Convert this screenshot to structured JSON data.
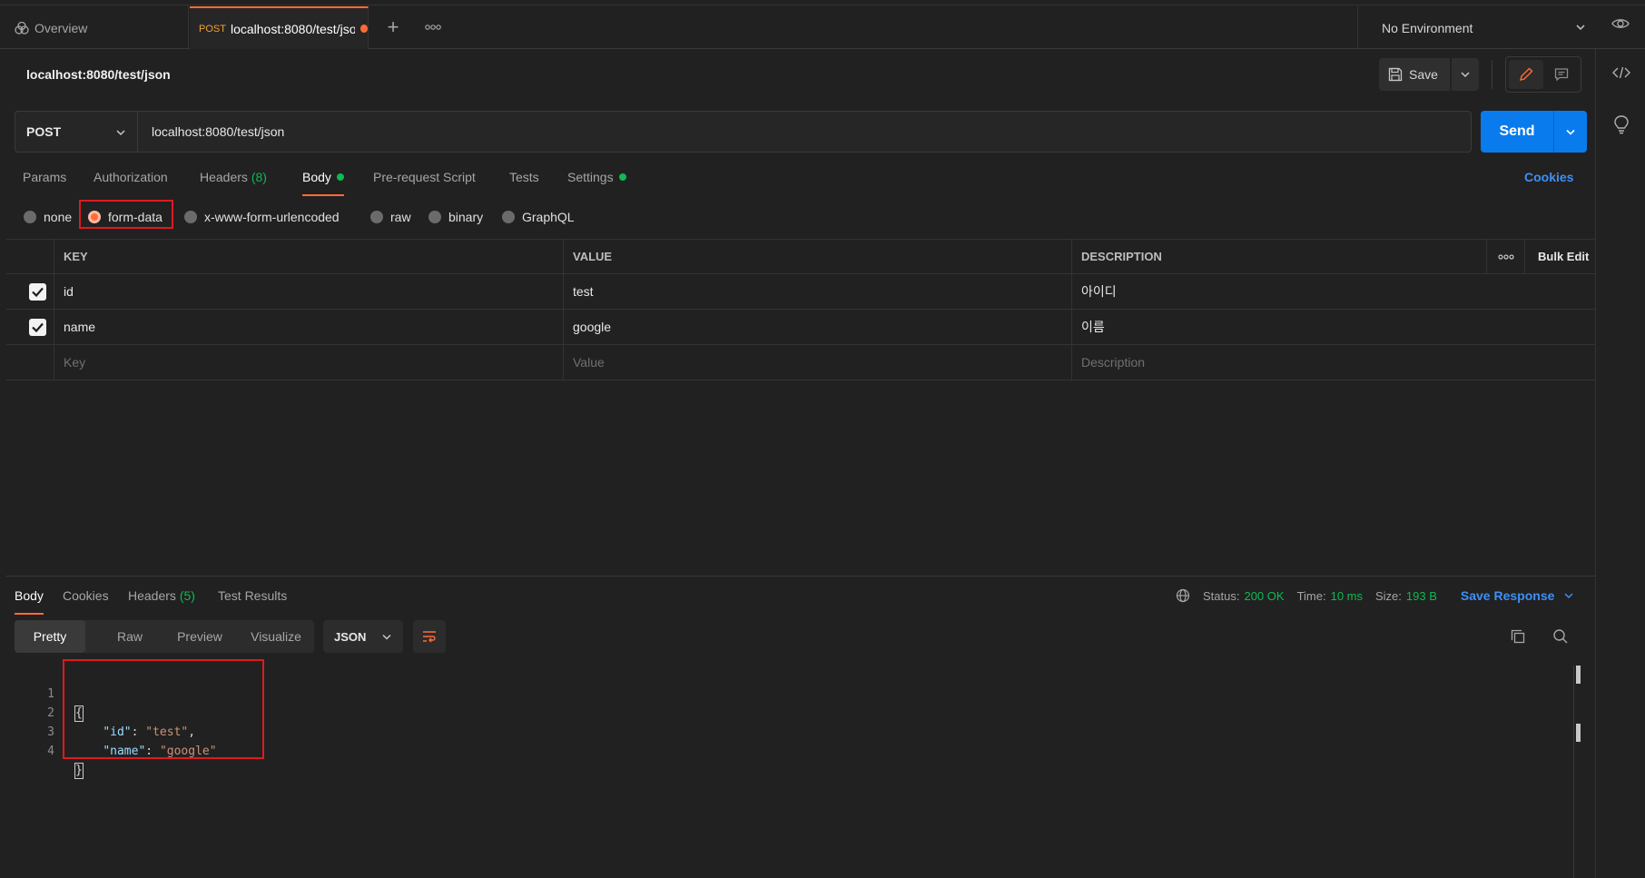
{
  "tabs": {
    "overview_label": "Overview",
    "active_method": "POST",
    "active_url": "localhost:8080/test/json",
    "plus": "+"
  },
  "environment": {
    "label": "No Environment"
  },
  "request": {
    "title": "localhost:8080/test/json",
    "save_label": "Save",
    "method": "POST",
    "url": "localhost:8080/test/json",
    "send_label": "Send"
  },
  "request_tabs": {
    "params": "Params",
    "authorization": "Authorization",
    "headers": "Headers",
    "headers_count": "(8)",
    "body": "Body",
    "prerequest": "Pre-request Script",
    "tests": "Tests",
    "settings": "Settings",
    "cookies": "Cookies"
  },
  "body_types": {
    "none": "none",
    "form_data": "form-data",
    "urlencoded": "x-www-form-urlencoded",
    "raw": "raw",
    "binary": "binary",
    "graphql": "GraphQL",
    "selected": "form-data"
  },
  "params_table": {
    "headers": {
      "key": "KEY",
      "value": "VALUE",
      "description": "DESCRIPTION",
      "bulk_edit": "Bulk Edit"
    },
    "rows": [
      {
        "checked": true,
        "key": "id",
        "value": "test",
        "description": "아이디"
      },
      {
        "checked": true,
        "key": "name",
        "value": "google",
        "description": "이름"
      }
    ],
    "placeholders": {
      "key": "Key",
      "value": "Value",
      "description": "Description"
    }
  },
  "response_tabs": {
    "body": "Body",
    "cookies": "Cookies",
    "headers": "Headers",
    "headers_count": "(5)",
    "test_results": "Test Results"
  },
  "response_status": {
    "status_label": "Status:",
    "status_value": "200 OK",
    "time_label": "Time:",
    "time_value": "10 ms",
    "size_label": "Size:",
    "size_value": "193 B",
    "save_response": "Save Response"
  },
  "response_view": {
    "pretty": "Pretty",
    "raw": "Raw",
    "preview": "Preview",
    "visualize": "Visualize",
    "format": "JSON"
  },
  "response_body": {
    "line_numbers": [
      "1",
      "2",
      "3",
      "4"
    ],
    "open_brace": "{",
    "close_brace": "}",
    "key1": "\"id\"",
    "val1": "\"test\"",
    "key2": "\"name\"",
    "val2": "\"google\""
  },
  "colors": {
    "accent": "#ff6c37",
    "send": "#097bed",
    "success": "#0cbb52",
    "link": "#3f8ff5",
    "highlight_box": "#e0191f"
  }
}
